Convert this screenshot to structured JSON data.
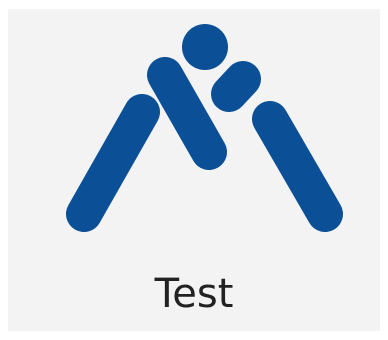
{
  "tile": {
    "label": "Test",
    "icon": "app-logo-icon",
    "colors": {
      "background": "#f3f3f3",
      "logo": "#0b4f96",
      "label": "#222222"
    }
  }
}
